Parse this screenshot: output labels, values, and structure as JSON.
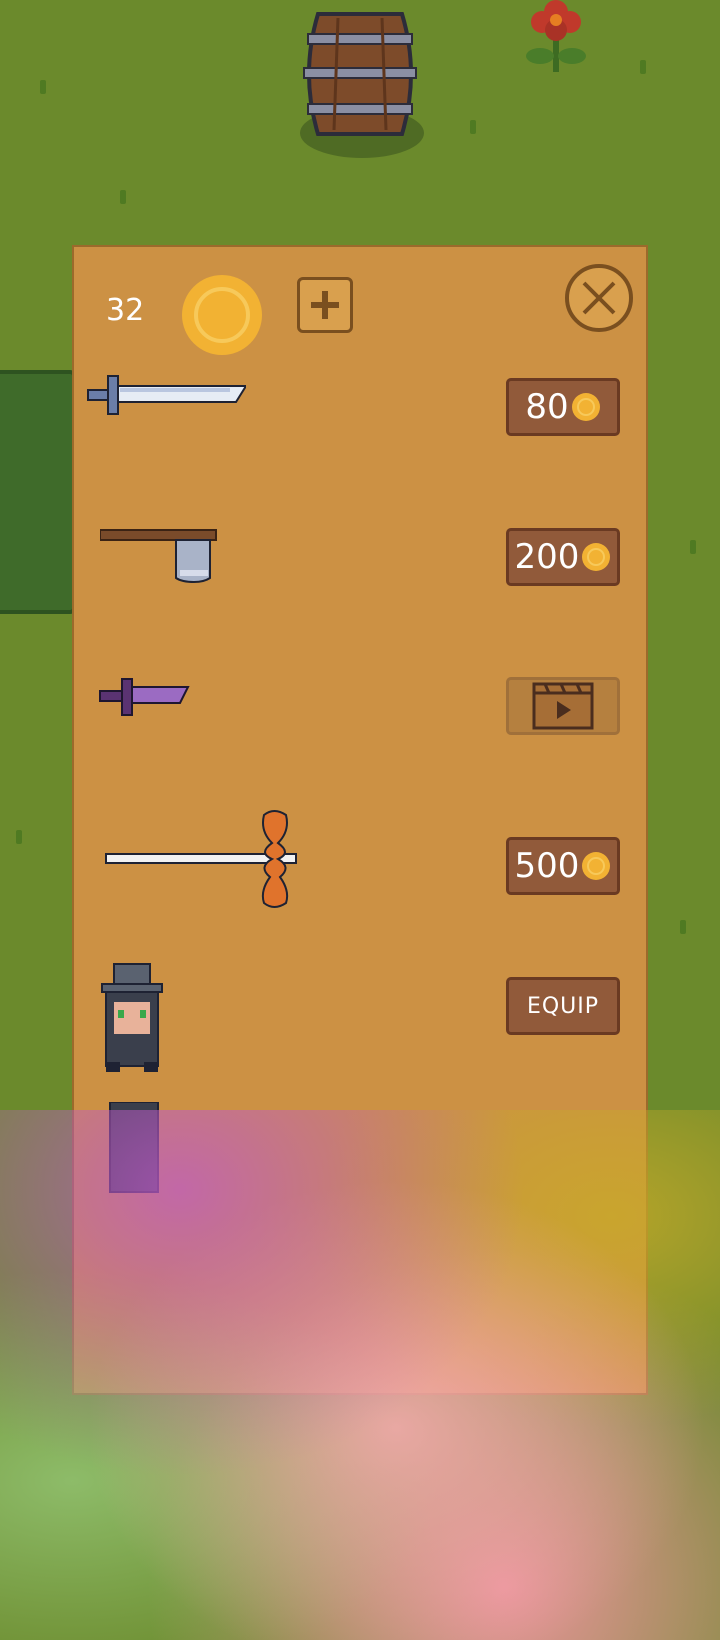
{
  "hud": {
    "coins": "32",
    "add_coins_label": "+"
  },
  "shop_items": [
    {
      "name": "sword",
      "price": "80"
    },
    {
      "name": "axe",
      "price": "200"
    },
    {
      "name": "dagger",
      "action": "watch-video"
    },
    {
      "name": "spear",
      "price": "500"
    },
    {
      "name": "hat-character",
      "button": "EQUIP"
    }
  ],
  "colors": {
    "grass": "#6b8a2c",
    "panel": "#cc9144",
    "button": "#915a3a",
    "coin": "#f2b233"
  }
}
